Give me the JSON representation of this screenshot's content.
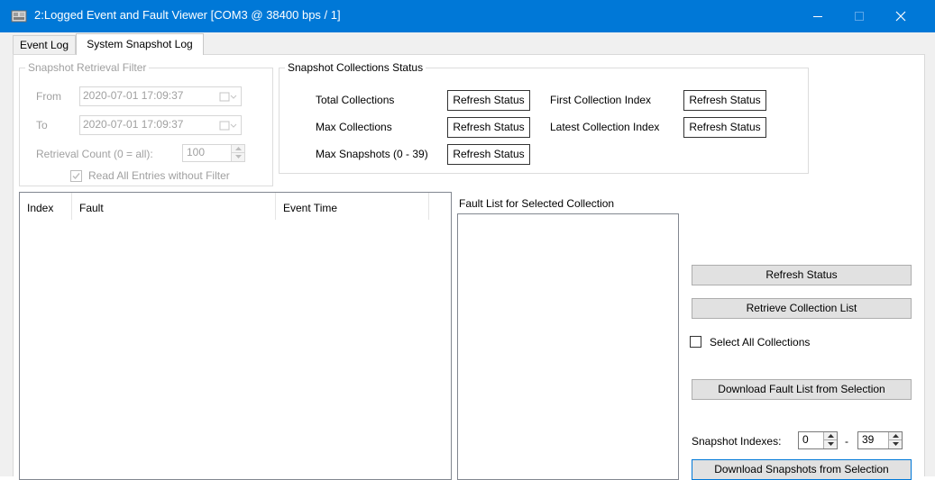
{
  "window": {
    "title": "2:Logged Event and Fault Viewer [COM3 @ 38400 bps / 1]",
    "accent_color": "#0078d7",
    "controls": [
      "minimize-icon",
      "maximize-icon",
      "close-icon"
    ]
  },
  "tabs": [
    {
      "label": "Event Log",
      "selected": false
    },
    {
      "label": "System Snapshot Log",
      "selected": true
    }
  ],
  "filter": {
    "legend": "Snapshot Retrieval Filter",
    "from_label": "From",
    "from_value": "2020-07-01  17:09:37",
    "to_label": "To",
    "to_value": "2020-07-01  17:09:37",
    "count_label": "Retrieval Count (0 = all):",
    "count_value": "100",
    "read_all_label": "Read All Entries without Filter",
    "read_all_checked": true,
    "enabled": false
  },
  "status": {
    "legend": "Snapshot Collections Status",
    "total_label": "Total Collections",
    "total_value": "Refresh Status",
    "max_label": "Max Collections",
    "max_value": "Refresh Status",
    "max_snapshots_label": "Max Snapshots (0 - 39)",
    "max_snapshots_value": "Refresh Status",
    "first_label": "First Collection Index",
    "first_value": "Refresh Status",
    "latest_label": "Latest Collection Index",
    "latest_value": "Refresh Status"
  },
  "collection_list": {
    "columns": [
      "Index",
      "Fault",
      "Event Time"
    ],
    "rows": []
  },
  "fault_list": {
    "label": "Fault List for Selected Collection",
    "items": []
  },
  "actions": {
    "refresh_status": "Refresh Status",
    "retrieve_list": "Retrieve Collection List",
    "select_all_label": "Select All Collections",
    "select_all_checked": false,
    "download_faults": "Download Fault List from Selection",
    "snapshot_indexes_label": "Snapshot Indexes:",
    "snapshot_from": "0",
    "snapshot_separator": "-",
    "snapshot_to": "39",
    "download_snapshots": "Download Snapshots from Selection"
  }
}
